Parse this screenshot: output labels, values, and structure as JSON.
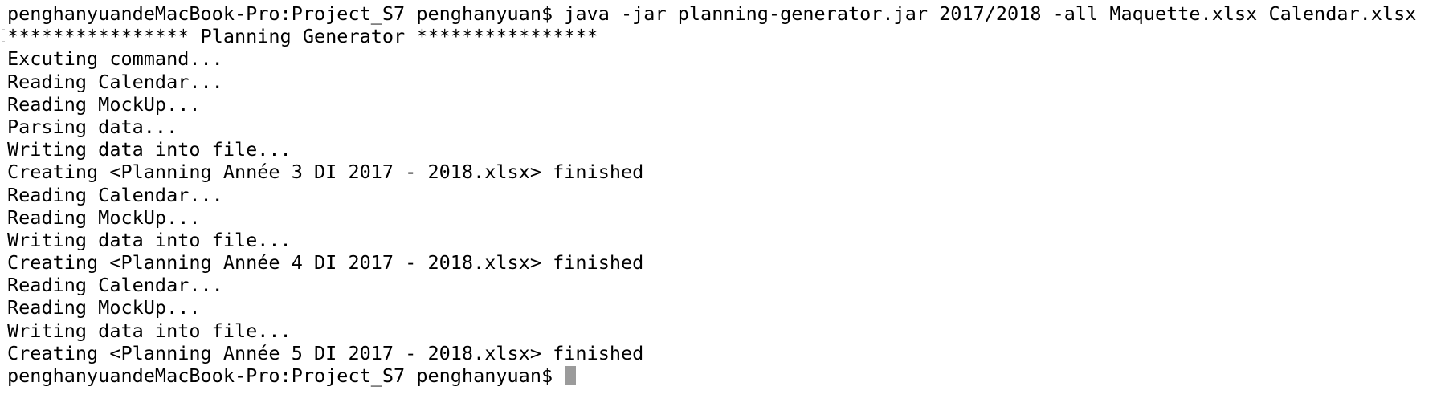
{
  "terminal": {
    "cursor_color": "#9b9b9b",
    "background_color": "#ffffff",
    "text_color": "#000000",
    "lines": [
      "penghanyuandeMacBook-Pro:Project_S7 penghanyuan$ java -jar planning-generator.jar 2017/2018 -all Maquette.xlsx Calendar.xlsx",
      "**************** Planning Generator ****************",
      "Excuting command...",
      "Reading Calendar...",
      "Reading MockUp...",
      "Parsing data...",
      "Writing data into file...",
      "Creating <Planning Année 3 DI 2017 - 2018.xlsx> finished",
      "Reading Calendar...",
      "Reading MockUp...",
      "Writing data into file...",
      "Creating <Planning Année 4 DI 2017 - 2018.xlsx> finished",
      "Reading Calendar...",
      "Reading MockUp...",
      "Writing data into file...",
      "Creating <Planning Année 5 DI 2017 - 2018.xlsx> finished"
    ],
    "prompt": "penghanyuandeMacBook-Pro:Project_S7 penghanyuan$ "
  }
}
